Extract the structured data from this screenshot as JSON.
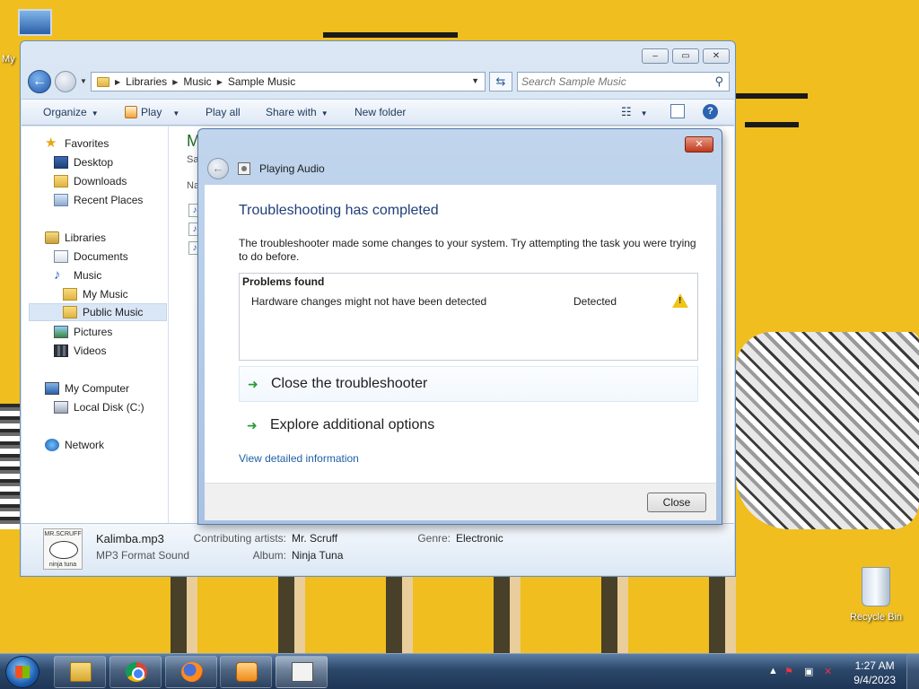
{
  "desktop": {
    "icons": {
      "my_computer": "My",
      "recycle_bin": "Recycle Bin"
    }
  },
  "explorer": {
    "controls": {
      "minimize": "–",
      "maximize": "▭",
      "close": "✕"
    },
    "breadcrumb": [
      "Libraries",
      "Music",
      "Sample Music"
    ],
    "search_placeholder": "Search Sample Music",
    "toolbar": {
      "organize": "Organize",
      "play": "Play",
      "play_all": "Play all",
      "share_with": "Share with",
      "new_folder": "New folder"
    },
    "nav": {
      "favorites": "Favorites",
      "desktop": "Desktop",
      "downloads": "Downloads",
      "recent_places": "Recent Places",
      "libraries": "Libraries",
      "documents": "Documents",
      "music": "Music",
      "my_music": "My Music",
      "public_music": "Public Music",
      "pictures": "Pictures",
      "videos": "Videos",
      "my_computer": "My Computer",
      "local_disk": "Local Disk (C:)",
      "network": "Network"
    },
    "file_pane": {
      "title_partial": "M",
      "subtitle_partial": "Sa",
      "column_partial": "Na"
    },
    "details": {
      "album_art": {
        "top": "MR.SCRUFF",
        "bottom": "ninja tuna"
      },
      "file_name": "Kalimba.mp3",
      "file_type": "MP3 Format Sound",
      "contributing_artists_label": "Contributing artists:",
      "contributing_artists": "Mr. Scruff",
      "album_label": "Album:",
      "album": "Ninja Tuna",
      "genre_label": "Genre:",
      "genre": "Electronic"
    }
  },
  "dialog": {
    "close_x": "✕",
    "title": "Playing Audio",
    "heading": "Troubleshooting has completed",
    "description": "The troubleshooter made some changes to your system. Try attempting the task you were trying to do before.",
    "problems": {
      "header": "Problems found",
      "items": [
        {
          "text": "Hardware changes might not have been detected",
          "status": "Detected",
          "icon": "warning-icon"
        }
      ]
    },
    "options": [
      {
        "label": "Close the troubleshooter",
        "icon": "green-arrow-icon"
      },
      {
        "label": "Explore additional options",
        "icon": "green-arrow-icon"
      }
    ],
    "link": "View detailed information",
    "close_button": "Close"
  },
  "taskbar": {
    "apps": [
      "Windows Explorer",
      "Google Chrome",
      "Mozilla Firefox",
      "Windows Media Player",
      "Troubleshooter"
    ],
    "time": "1:27 AM",
    "date": "9/4/2023"
  },
  "colors": {
    "wallpaper": "#f0be1e",
    "dialog_heading": "#1e3f78",
    "link": "#1f5fa8",
    "close_red": "#c0391e",
    "green_arrow": "#2a9a3a"
  }
}
